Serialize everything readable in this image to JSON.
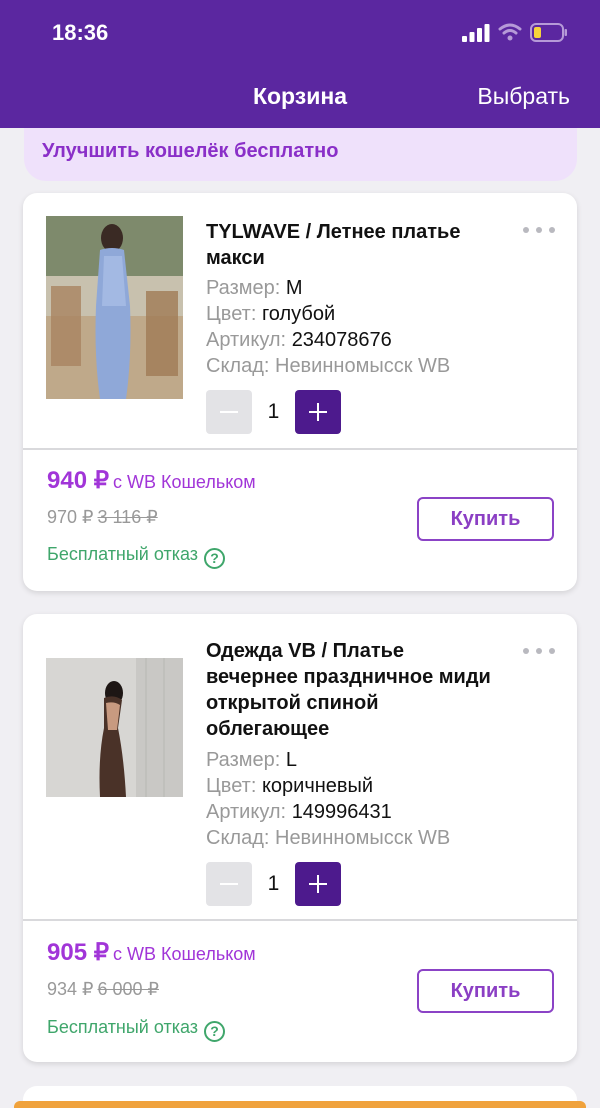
{
  "status": {
    "time": "18:36"
  },
  "header": {
    "title": "Корзина",
    "select_label": "Выбрать"
  },
  "banner": {
    "text": "Улучшить кошелёк бесплатно"
  },
  "items": [
    {
      "name": "TYLWAVE / Летнее платье макси",
      "size_label": "Размер:",
      "size": "M",
      "color_label": "Цвет:",
      "color": "голубой",
      "article_label": "Артикул:",
      "article": "234078676",
      "warehouse": "Склад: Невинномысск WB",
      "quantity": "1",
      "price": "940 ₽",
      "wallet_text": "с WB Кошельком",
      "old_price": "970 ₽",
      "crossed_price": "3 116 ₽",
      "free_return": "Бесплатный отказ",
      "buy_label": "Купить"
    },
    {
      "name": "Одежда VB / Платье вечернее праздничное миди открытой спиной облегающее",
      "size_label": "Размер:",
      "size": "L",
      "color_label": "Цвет:",
      "color": "коричневый",
      "article_label": "Артикул:",
      "article": "149996431",
      "warehouse": "Склад: Невинномысск WB",
      "quantity": "1",
      "price": "905 ₽",
      "wallet_text": "с WB Кошельком",
      "old_price": "934 ₽",
      "crossed_price": "6 000 ₽",
      "free_return": "Бесплатный отказ",
      "buy_label": "Купить"
    }
  ],
  "colors": {
    "header": "#5b27a0",
    "accent": "#a135d8",
    "banner_bg": "#efe1fb",
    "success": "#3fa66b",
    "qty_plus": "#4d1a8d"
  }
}
